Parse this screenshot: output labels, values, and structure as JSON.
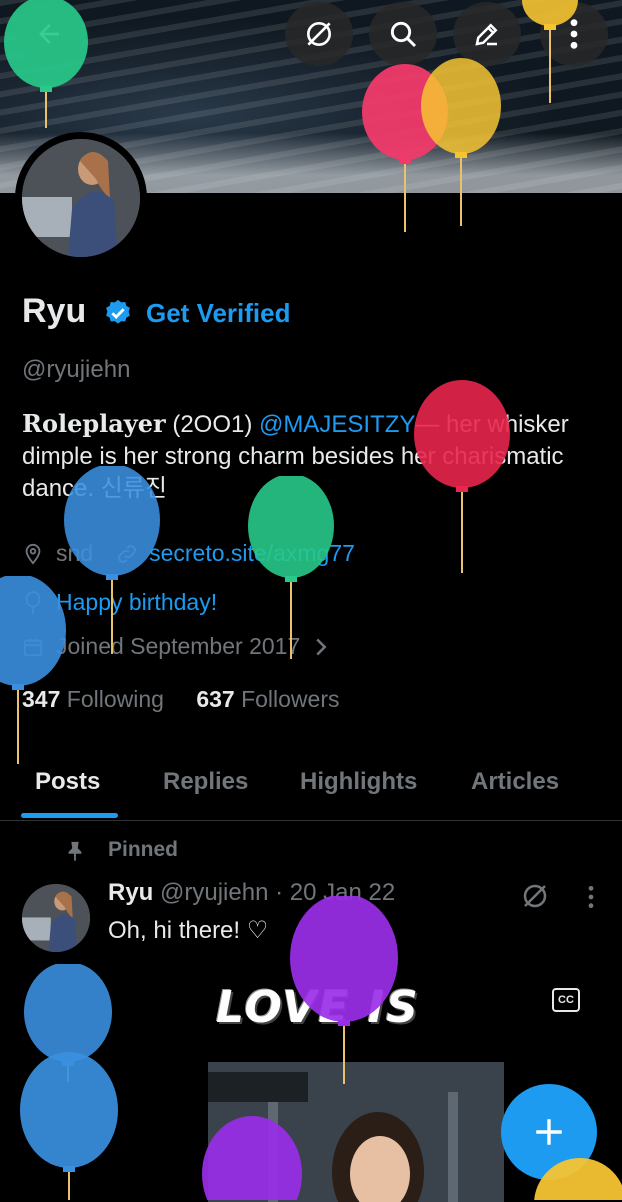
{
  "profile": {
    "name": "Ryu",
    "get_verified": "Get Verified",
    "handle": "@ryujiehn",
    "bio_prefix": "Roleplayer",
    "bio_year": " (2OO1) ",
    "bio_mention": "@MAJESITZY",
    "bio_rest": "— her whisker dimple is her strong charm besides her charismatic dance. 신류진",
    "location": "snd",
    "website": "secreto.site/axmg77",
    "birthday": "Happy birthday!",
    "joined": "Joined September 2017",
    "following_count": "347",
    "following_label": "Following",
    "followers_count": "637",
    "followers_label": "Followers"
  },
  "tabs": [
    {
      "label": "Posts"
    },
    {
      "label": "Replies"
    },
    {
      "label": "Highlights"
    },
    {
      "label": "Articles"
    }
  ],
  "post": {
    "pinned_label": "Pinned",
    "author": "Ryu",
    "handle": "@ryujiehn",
    "date": "· 20 Jan 22",
    "text": "Oh, hi there! ♡",
    "media_caption": "LOVE IS",
    "cc_label": "CC"
  },
  "icons": {
    "back": "back-arrow-icon",
    "grok": "grok-icon",
    "search": "search-icon",
    "edit": "edit-icon",
    "more": "more-vertical-icon",
    "compose": "plus-icon"
  },
  "colors": {
    "accent": "#1d9bf0",
    "text": "#e7e9ea",
    "muted": "#71767b",
    "background": "#000000"
  }
}
